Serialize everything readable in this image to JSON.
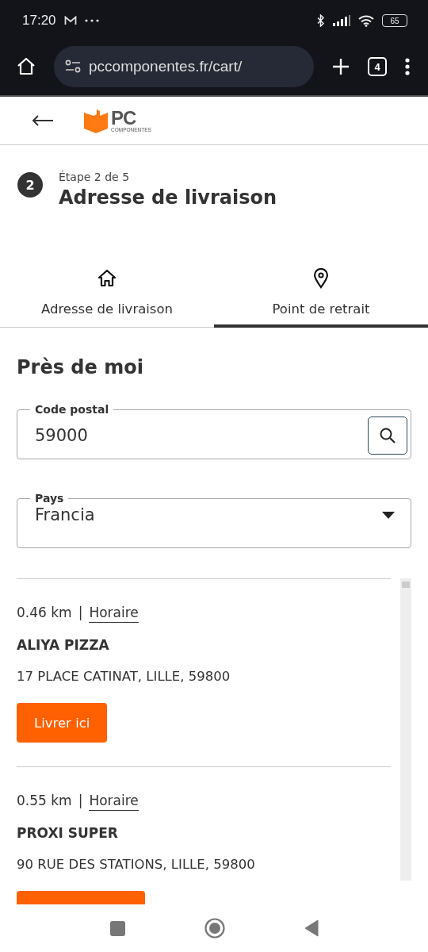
{
  "status_bar": {
    "time": "17:20",
    "battery": "65"
  },
  "browser": {
    "url": "pccomponentes.fr/cart/",
    "tab_count": "4"
  },
  "header": {
    "logo_main": "PC",
    "logo_sub": "COMPONENTES"
  },
  "step": {
    "number": "2",
    "caption": "Étape 2 de 5",
    "title": "Adresse de livraison"
  },
  "tabs": [
    {
      "label": "Adresse de livraison",
      "kind": "home",
      "selected": false
    },
    {
      "label": "Point de retrait",
      "kind": "pin",
      "selected": true
    }
  ],
  "section_title": "Près de moi",
  "postal_code": {
    "label": "Code postal",
    "value": "59000"
  },
  "country": {
    "label": "Pays",
    "value": "Francia"
  },
  "points": [
    {
      "distance": "0.46 km",
      "separator": "|",
      "hours_link": "Horaire",
      "name": "ALIYA PIZZA",
      "address": "17 PLACE CATINAT, LILLE, 59800",
      "button": "Livrer ici"
    },
    {
      "distance": "0.55 km",
      "separator": "|",
      "hours_link": "Horaire",
      "name": "PROXI SUPER",
      "address": "90 RUE DES STATIONS, LILLE, 59800",
      "button_partial": true
    }
  ]
}
